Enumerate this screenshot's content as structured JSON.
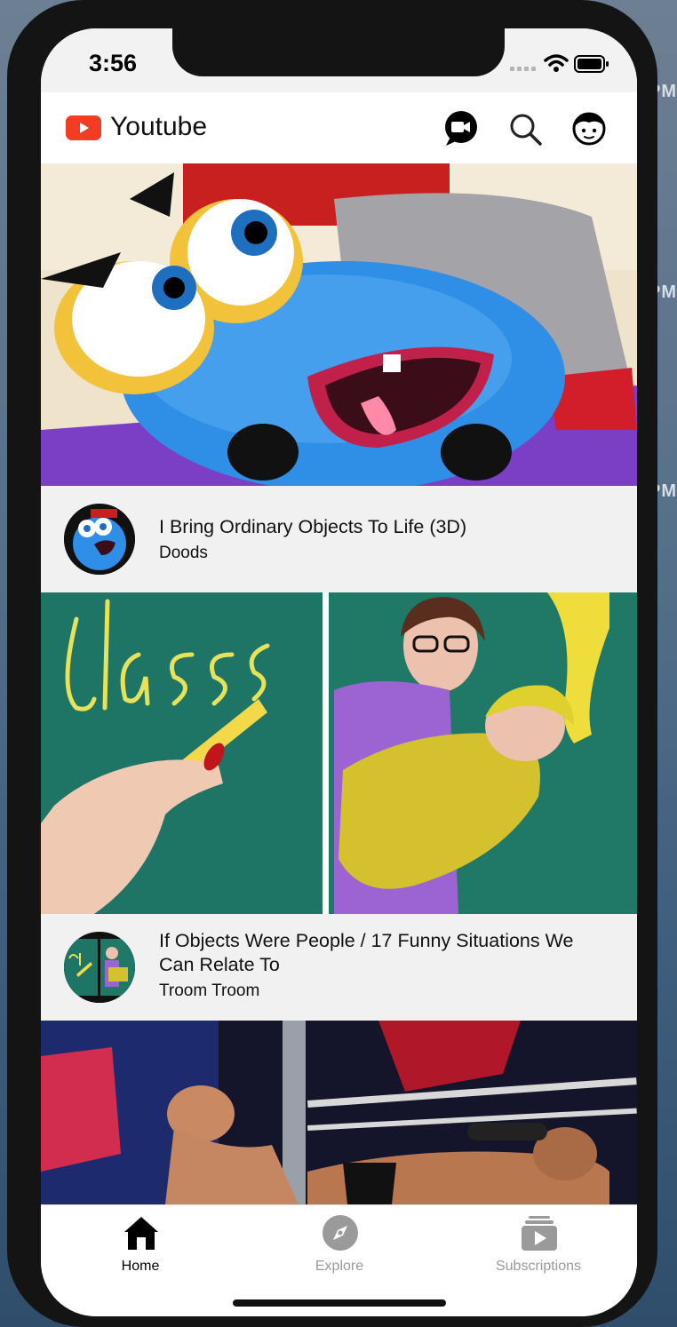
{
  "desktop": {
    "edge_labels": [
      "PM",
      "PM",
      "PM"
    ]
  },
  "status_bar": {
    "time": "3:56"
  },
  "header": {
    "title": "Youtube",
    "brand_color": "#ff0000"
  },
  "videos": [
    {
      "title": "I Bring Ordinary Objects To Life (3D)",
      "channel": "Doods"
    },
    {
      "title": "If Objects Were People / 17 Funny Situations We Can Relate To",
      "channel": "Troom Troom"
    },
    {
      "title": "",
      "channel": ""
    }
  ],
  "tabs": [
    {
      "label": "Home",
      "icon": "home-icon",
      "active": true
    },
    {
      "label": "Explore",
      "icon": "compass-icon",
      "active": false
    },
    {
      "label": "Subscriptions",
      "icon": "subscriptions-icon",
      "active": false
    }
  ],
  "colors": {
    "active_tab": "#000000",
    "inactive_tab": "#9a9a9a"
  }
}
